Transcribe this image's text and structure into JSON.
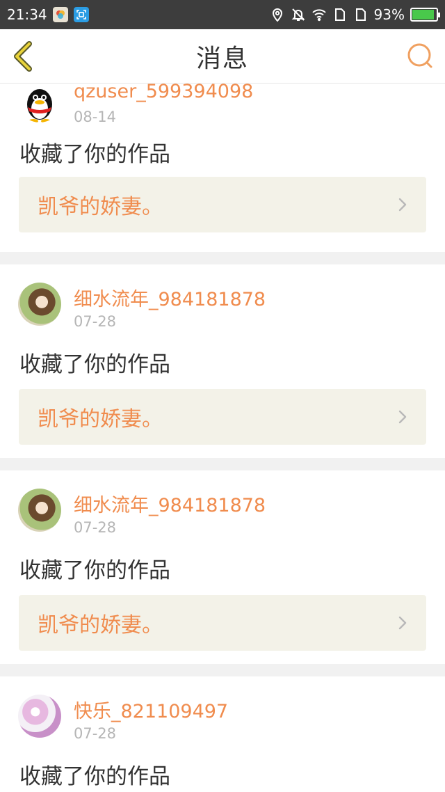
{
  "status_bar": {
    "time": "21:34",
    "battery": "93%",
    "battery_level": 0.93
  },
  "nav": {
    "title": "消息",
    "back_icon": "back-chevron-icon",
    "search_icon": "search-icon"
  },
  "colors": {
    "accent": "#f08c4e",
    "card_link_bg": "#f3f2e8",
    "status_bar_bg": "#3d3d3d"
  },
  "messages": [
    {
      "username": "qzuser_599394098",
      "date": "08-14",
      "action": "收藏了你的作品",
      "work_title": "凯爷的娇妻。",
      "avatar": "qq-penguin-avatar"
    },
    {
      "username": "细水流年_984181878",
      "date": "07-28",
      "action": "收藏了你的作品",
      "work_title": "凯爷的娇妻。",
      "avatar": "girl-photo-avatar"
    },
    {
      "username": "细水流年_984181878",
      "date": "07-28",
      "action": "收藏了你的作品",
      "work_title": "凯爷的娇妻。",
      "avatar": "girl-photo-avatar"
    },
    {
      "username": "快乐_821109497",
      "date": "07-28",
      "action": "收藏了你的作品",
      "avatar": "flower-photo-avatar"
    }
  ]
}
